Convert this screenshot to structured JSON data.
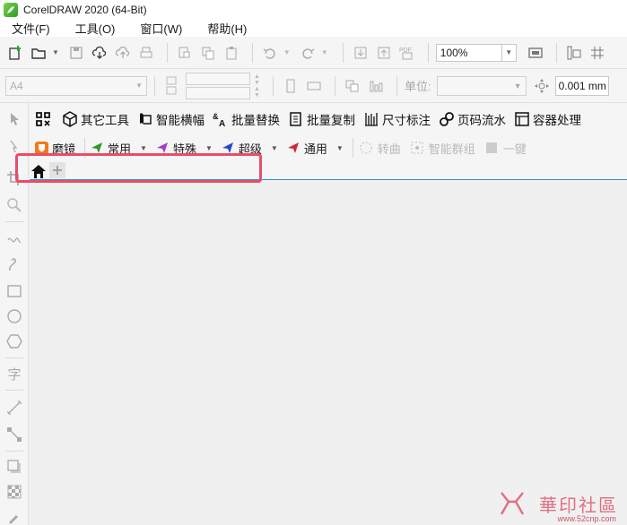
{
  "window": {
    "title": "CorelDRAW 2020 (64-Bit)"
  },
  "menu": [
    "文件(F)",
    "工具(O)",
    "窗口(W)",
    "帮助(H)"
  ],
  "toolbar": {
    "zoom_value": "100%"
  },
  "property_bar": {
    "page_size": "A4",
    "unit_label": "单位:",
    "nudge_value": "0.001 mm"
  },
  "plugin_toolbar": {
    "items": [
      "其它工具",
      "智能横幅",
      "批量替换",
      "批量复制",
      "尺寸标注",
      "页码流水",
      "容器处理"
    ]
  },
  "plugin_toolbar2": {
    "mirror_label": "磨镜",
    "groups": [
      "常用",
      "特殊",
      "超级",
      "通用"
    ],
    "disabled_items": [
      "转曲",
      "智能群组",
      "一键"
    ]
  },
  "watermark": {
    "text": "華印社區",
    "url": "www.52cnp.com"
  },
  "colors": {
    "accent_blue": "#2d8fd5",
    "highlight_red": "#ea4d67",
    "logo_green": "#4cb03a"
  }
}
